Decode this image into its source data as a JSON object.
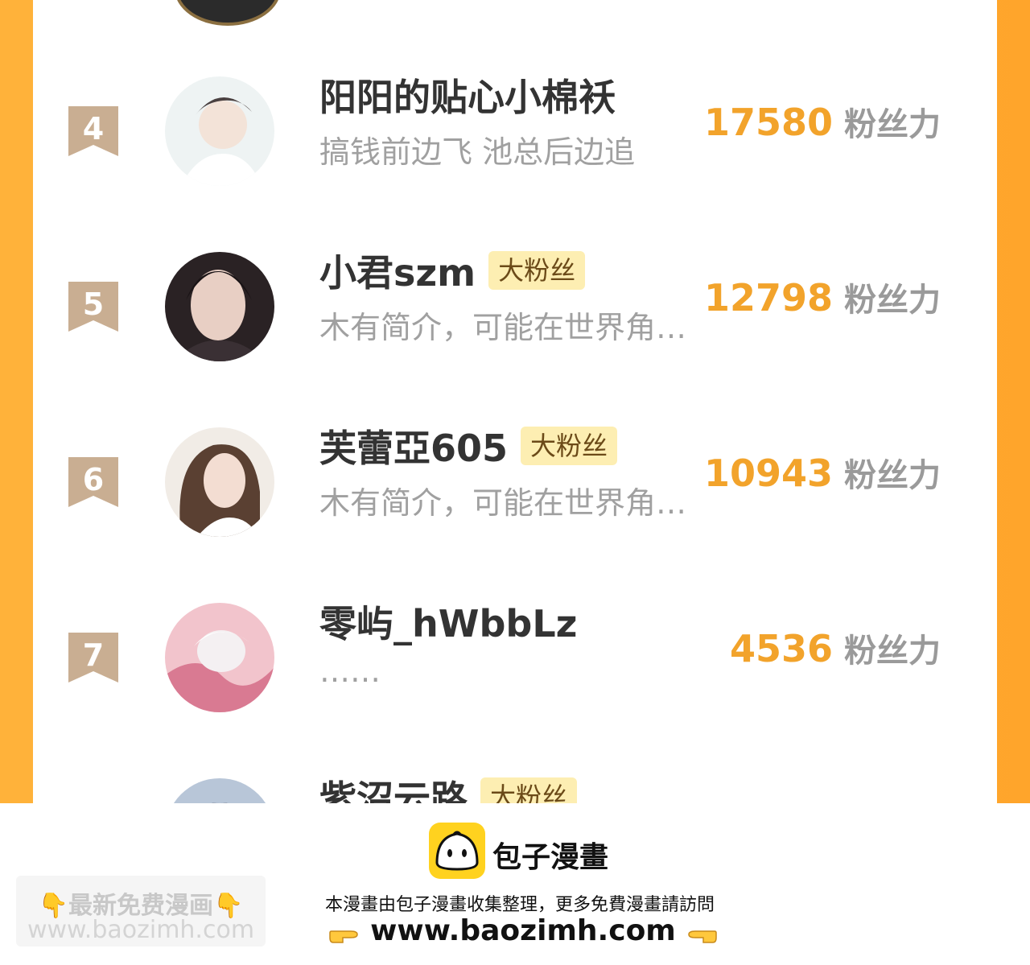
{
  "ranking": {
    "entries": [
      {
        "rank": "4",
        "name": "阳阳的贴心小棉袄",
        "badge": "",
        "bio": "搞钱前边飞 池总后边追",
        "score": "17580",
        "unit": "粉丝力"
      },
      {
        "rank": "5",
        "name": "小君szm",
        "badge": "大粉丝",
        "bio": "木有简介，可能在世界角…",
        "score": "12798",
        "unit": "粉丝力"
      },
      {
        "rank": "6",
        "name": "芙蕾亞605",
        "badge": "大粉丝",
        "bio": "木有简介，可能在世界角…",
        "score": "10943",
        "unit": "粉丝力"
      },
      {
        "rank": "7",
        "name": "零屿_hWbbLz",
        "badge": "",
        "bio": "……",
        "score": "4536",
        "unit": "粉丝力"
      },
      {
        "rank": "",
        "name": "紫沼云路",
        "badge": "大粉丝",
        "bio": "",
        "score": "",
        "unit": ""
      }
    ],
    "colors": {
      "accent": "#f2a32b",
      "rank_badge": "#c9ae92",
      "frame": "#ffa52b",
      "fan_badge_bg": "#fdeeb2"
    }
  },
  "footer": {
    "brand": "包子漫畫",
    "notice": "本漫畫由包子漫畫收集整理，更多免費漫畫請訪問",
    "url": "www.baozimh.com",
    "watermark_line1": "👇最新免费漫画👇",
    "watermark_line2": "www.baozimh.com",
    "icons": [
      "bun-logo-icon",
      "pointing-right-hand-icon",
      "pointing-left-hand-icon"
    ]
  }
}
